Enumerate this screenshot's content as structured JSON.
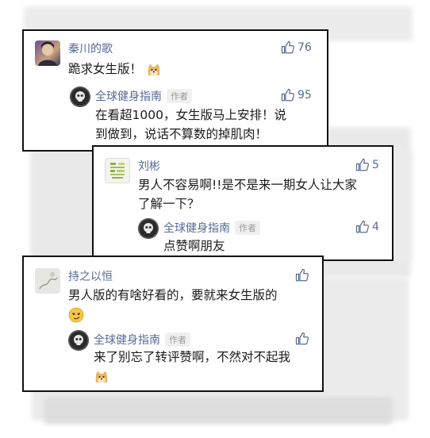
{
  "comments": [
    {
      "author": "秦川的歌",
      "text": "跪求女生版！",
      "likes": "76",
      "reply": {
        "author": "全球健身指南",
        "badge": "作者",
        "text_line1": "在看超1000，女生版马上安排！说",
        "text_line2": "到做到，说话不算数的掉肌肉！",
        "likes": "95"
      }
    },
    {
      "author": "刘彬",
      "text_line1": "男人不容易啊!!是不是来一期女人让大家",
      "text_line2": "了解一下？",
      "likes": "5",
      "reply": {
        "author": "全球健身指南",
        "badge": "作者",
        "text": "点赞啊朋友",
        "likes": "4"
      }
    },
    {
      "author": "持之以恒",
      "text": "男人版的有啥好看的，要就来女生版的",
      "likes": "",
      "reply": {
        "author": "全球健身指南",
        "badge": "作者",
        "text": "来了别忘了转评赞啊，不然对不起我",
        "likes": ""
      }
    }
  ],
  "icons": {
    "like": "thumbs-up-icon",
    "emoji_doge": "doge-emoji-icon",
    "emoji_smirk": "smirk-emoji-icon"
  },
  "colors": {
    "name": "#576b95",
    "text": "#1b1b1b",
    "badge_bg": "#f0f0f0",
    "border": "#111111"
  }
}
